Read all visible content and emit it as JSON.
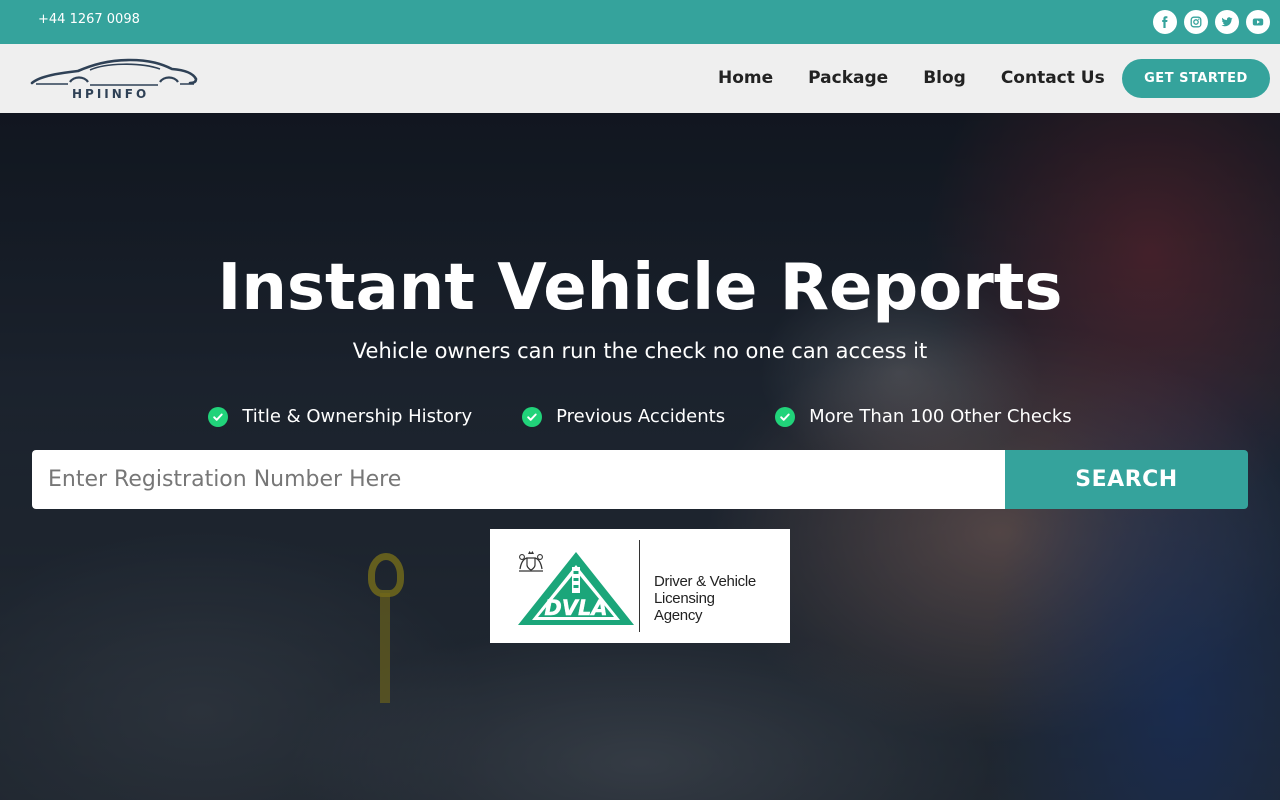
{
  "topbar": {
    "phone": "+44 1267 0098",
    "socials": [
      "facebook-icon",
      "instagram-icon",
      "twitter-icon",
      "youtube-icon"
    ]
  },
  "header": {
    "logo_text": "HPIINFO",
    "nav": [
      {
        "label": "Home"
      },
      {
        "label": "Package"
      },
      {
        "label": "Blog"
      },
      {
        "label": "Contact Us"
      }
    ],
    "cta_label": "GET STARTED"
  },
  "hero": {
    "title": "Instant Vehicle Reports",
    "subtitle": "Vehicle owners can run the check no one can access it",
    "features": [
      {
        "label": "Title & Ownership History"
      },
      {
        "label": "Previous Accidents"
      },
      {
        "label": "More Than 100 Other Checks"
      }
    ],
    "search": {
      "placeholder": "Enter Registration Number Here",
      "button_label": "SEARCH"
    },
    "partner": {
      "abbr": "DVLA",
      "name_lines": [
        "Driver & Vehicle",
        "Licensing",
        "Agency"
      ]
    }
  },
  "colors": {
    "accent": "#35a39c",
    "check": "#21d37a",
    "dvla_green": "#1ba67a"
  }
}
